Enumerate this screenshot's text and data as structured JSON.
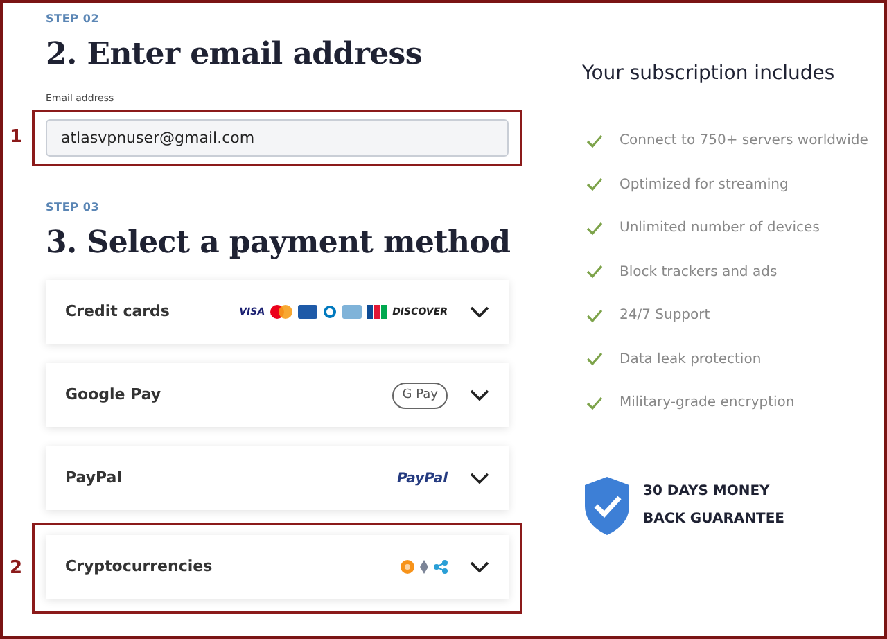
{
  "step_email": {
    "step": "STEP 02",
    "title": "2. Enter email address",
    "field_label": "Email address",
    "value": "atlasvpnuser@gmail.com",
    "annotation": "1"
  },
  "step_payment": {
    "step": "STEP 03",
    "title": "3. Select a payment method",
    "methods": [
      {
        "name": "Credit cards",
        "expanded": false,
        "logos": [
          {
            "kind": "wordmark",
            "text": "VISA",
            "color": "#1a1f71"
          },
          {
            "kind": "mastercard"
          },
          {
            "kind": "card",
            "color": "#1e5aa8"
          },
          {
            "kind": "diners"
          },
          {
            "kind": "card",
            "color": "#7fb3d9"
          },
          {
            "kind": "jcb"
          },
          {
            "kind": "wordmark",
            "text": "DISCOVER",
            "color": "#222222"
          }
        ]
      },
      {
        "name": "Google Pay",
        "expanded": false,
        "logos": [
          {
            "kind": "gpay",
            "text": "G Pay"
          }
        ]
      },
      {
        "name": "PayPal",
        "expanded": false,
        "logos": [
          {
            "kind": "paypal",
            "text": "PayPal"
          }
        ]
      },
      {
        "name": "Cryptocurrencies",
        "expanded": false,
        "annotation": "2",
        "logos": [
          {
            "kind": "bitcoin"
          },
          {
            "kind": "ethereum"
          },
          {
            "kind": "ripple"
          }
        ]
      }
    ]
  },
  "subscription": {
    "title": "Your subscription includes",
    "features": [
      "Connect to 750+ servers worldwide",
      "Optimized for streaming",
      "Unlimited number of devices",
      "Block trackers and ads",
      "24/7 Support",
      "Data leak protection",
      "Military-grade encryption"
    ],
    "guarantee": [
      "30 DAYS MONEY",
      "BACK GUARANTEE"
    ]
  }
}
